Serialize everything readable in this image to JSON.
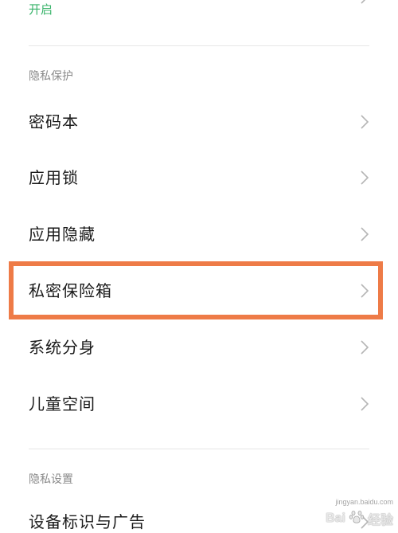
{
  "top_item": {
    "status": "开启"
  },
  "sections": [
    {
      "header": "隐私保护",
      "items": [
        "密码本",
        "应用锁",
        "应用隐藏",
        "私密保险箱",
        "系统分身",
        "儿童空间"
      ]
    },
    {
      "header": "隐私设置",
      "items": [
        "设备标识与广告"
      ]
    }
  ],
  "highlight": {
    "item": "私密保险箱",
    "color": "#ee7b47"
  },
  "colors": {
    "status_green": "#38b36a",
    "chevron": "#b5b5b5"
  },
  "watermark": {
    "brand": "Bai",
    "paw": "paw-icon",
    "cn": "经验",
    "url": "jingyan.baidu.com"
  }
}
